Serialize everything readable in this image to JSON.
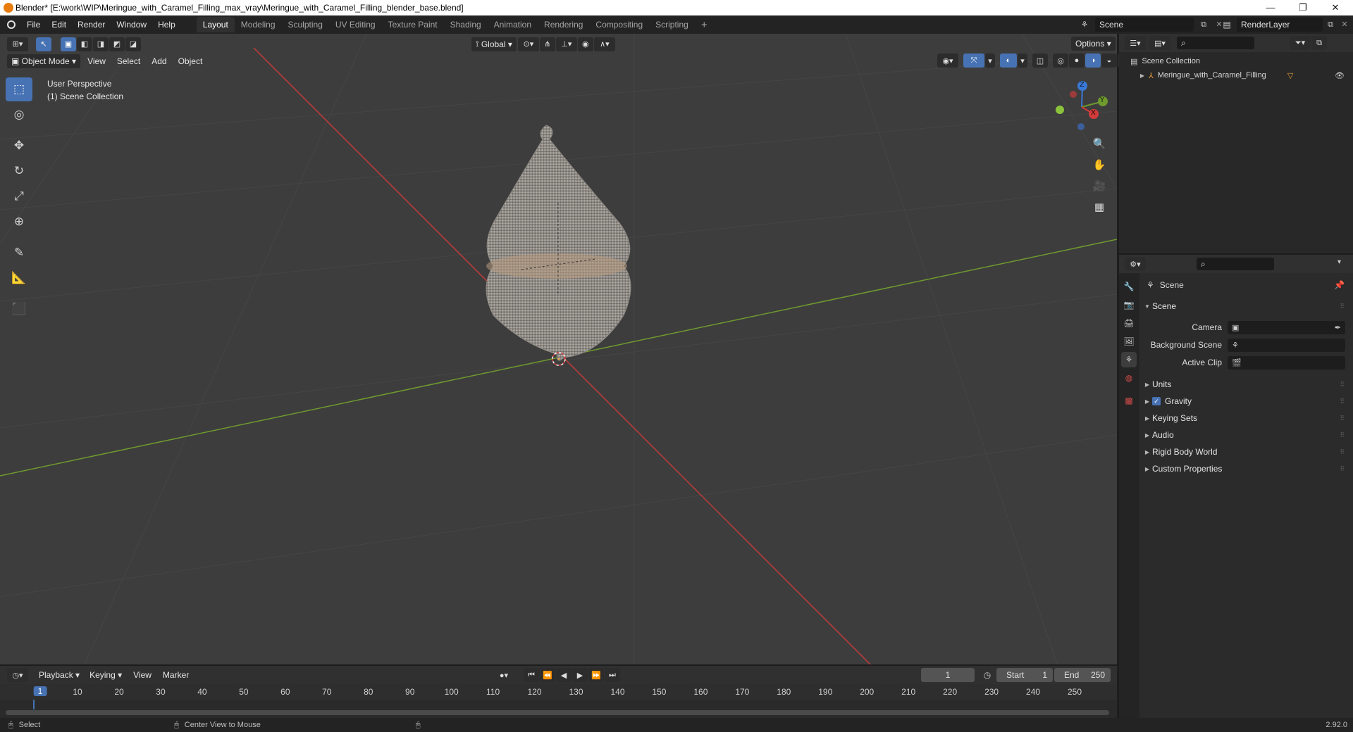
{
  "window": {
    "title": "Blender* [E:\\work\\WIP\\Meringue_with_Caramel_Filling_max_vray\\Meringue_with_Caramel_Filling_blender_base.blend]",
    "minimize": "—",
    "restore": "❐",
    "close": "✕"
  },
  "menu": {
    "items": [
      "File",
      "Edit",
      "Render",
      "Window",
      "Help"
    ]
  },
  "workspaces": {
    "tabs": [
      "Layout",
      "Modeling",
      "Sculpting",
      "UV Editing",
      "Texture Paint",
      "Shading",
      "Animation",
      "Rendering",
      "Compositing",
      "Scripting"
    ],
    "active": "Layout",
    "add_label": "+"
  },
  "scene_selector": {
    "value": "Scene"
  },
  "view_layer_selector": {
    "value": "RenderLayer"
  },
  "viewport": {
    "mode": "Object Mode",
    "menus": [
      "View",
      "Select",
      "Add",
      "Object"
    ],
    "transform_orientation": "Global",
    "options_label": "Options",
    "info_line1": "User Perspective",
    "info_line2": "(1) Scene Collection",
    "gizmo": {
      "z": "Z",
      "y": "Y",
      "x": "X"
    }
  },
  "outliner": {
    "root": "Scene Collection",
    "items": [
      {
        "label": "Meringue_with_Caramel_Filling"
      }
    ]
  },
  "properties": {
    "context": "Scene",
    "panel_title": "Scene",
    "fields": [
      {
        "label": "Camera",
        "value": ""
      },
      {
        "label": "Background Scene",
        "value": ""
      },
      {
        "label": "Active Clip",
        "value": ""
      }
    ],
    "subpanels": [
      "Units",
      "Gravity",
      "Keying Sets",
      "Audio",
      "Rigid Body World",
      "Custom Properties"
    ],
    "gravity_checked": true
  },
  "timeline": {
    "menus": [
      "Playback",
      "Keying",
      "View",
      "Marker"
    ],
    "current_frame": "1",
    "start_label": "Start",
    "start_value": "1",
    "end_label": "End",
    "end_value": "250",
    "ticks": [
      "1",
      "10",
      "20",
      "30",
      "40",
      "50",
      "60",
      "70",
      "80",
      "90",
      "100",
      "110",
      "120",
      "130",
      "140",
      "150",
      "160",
      "170",
      "180",
      "190",
      "200",
      "210",
      "220",
      "230",
      "240",
      "250"
    ]
  },
  "status": {
    "left": "Select",
    "middle": "Center View to Mouse",
    "version": "2.92.0"
  },
  "colors": {
    "accent": "#4772b3",
    "x_axis": "#c23b3b",
    "y_axis": "#6f9a2e"
  }
}
